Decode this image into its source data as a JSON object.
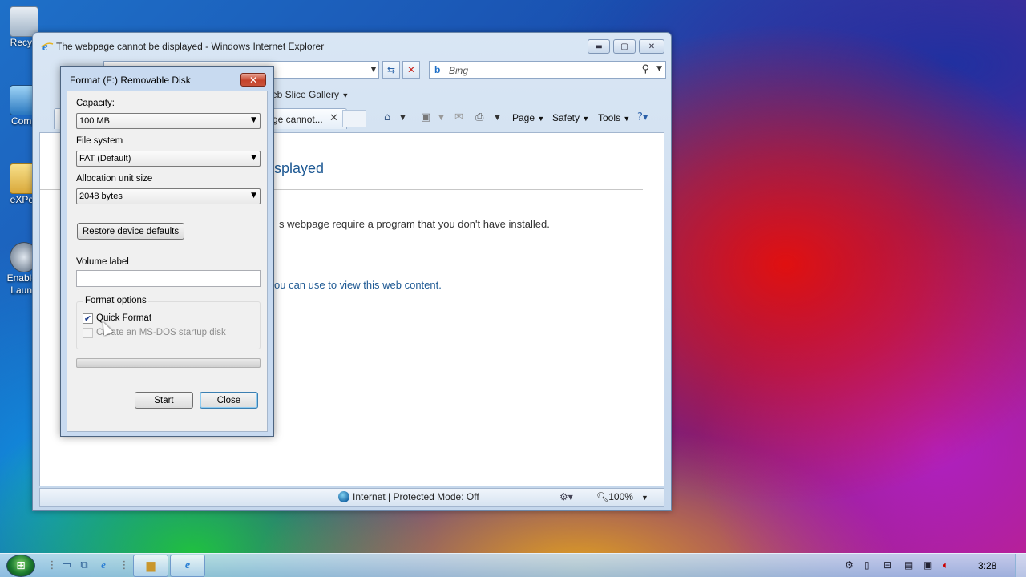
{
  "desktop": {
    "icons": [
      {
        "label": "Recyc",
        "icon": "recycle-bin-icon"
      },
      {
        "label": "Comp",
        "icon": "computer-icon"
      },
      {
        "label": "eXPer",
        "icon": "folder-icon"
      },
      {
        "label": "Enable",
        "label2": "Launc",
        "icon": "app-icon"
      }
    ]
  },
  "ie": {
    "title": "The webpage cannot be displayed - Windows Internet Explorer",
    "search_placeholder": "Bing",
    "favorites_item": "eb Slice Gallery",
    "tab_label": "ge cannot...",
    "commands": {
      "page": "Page",
      "safety": "Safety",
      "tools": "Tools"
    },
    "content": {
      "heading": "splayed",
      "text": "s webpage require a program that you don't have installed.",
      "link": "ou can use to view this web content."
    },
    "status": {
      "zone": "Internet | Protected Mode: Off",
      "zoom": "100%"
    }
  },
  "format_dialog": {
    "title": "Format (F:) Removable Disk",
    "capacity_label": "Capacity:",
    "capacity_value": "100 MB",
    "filesystem_label": "File system",
    "filesystem_value": "FAT (Default)",
    "allocation_label": "Allocation unit size",
    "allocation_value": "2048 bytes",
    "restore_button": "Restore device defaults",
    "volume_label": "Volume label",
    "volume_value": "",
    "format_options_label": "Format options",
    "quick_format_label": "Quick Format",
    "quick_format_checked": true,
    "msdos_label": "Create an MS-DOS startup disk",
    "msdos_checked": false,
    "progress": 0,
    "start_button": "Start",
    "close_button": "Close"
  },
  "taskbar": {
    "clock": "3:28"
  },
  "colors": {
    "ie_link": "#1f5a94",
    "dialog_frame": "#c8daf0",
    "close_button": "#c6442c"
  }
}
